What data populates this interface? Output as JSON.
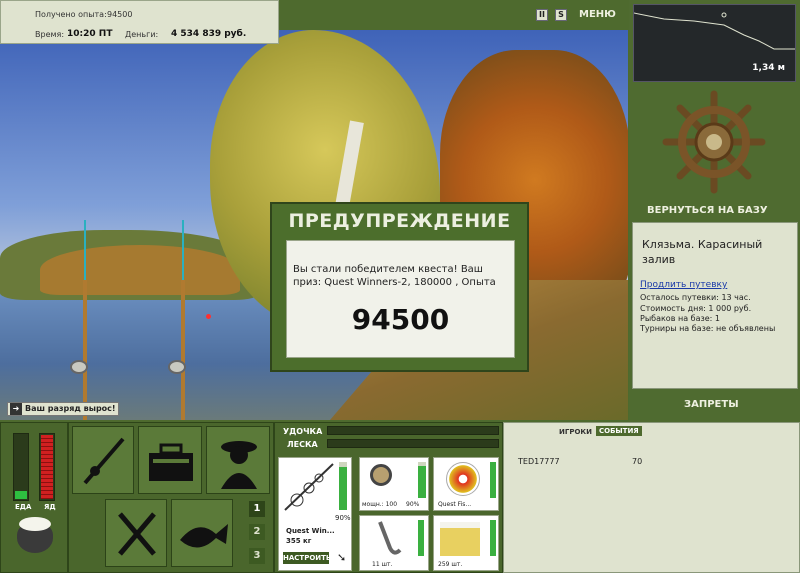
{
  "info": {
    "experience_label": "Получено опыта:",
    "experience_value": "94500",
    "time_label": "Время:",
    "time_value": "10:20 ПТ",
    "money_label": "Деньги:",
    "money_value": "4 534 839 руб."
  },
  "top_controls": {
    "pause": "II",
    "sound": "S",
    "menu": "МЕНЮ"
  },
  "rank_notice": "Ваш разряд вырос!",
  "dialog": {
    "title": "ПРЕДУПРЕЖДЕНИЕ",
    "message": "Вы стали победителем квеста! Ваш приз: Quest Winners-2, 180000 , Опыта",
    "number": "94500"
  },
  "depth": {
    "value": "1,34 м"
  },
  "right_panel": {
    "return_button": "ВЕРНУТЬСЯ НА БАЗУ",
    "location_title": "Клязьма. Карасиный залив",
    "extend_link": "Продлить путевку",
    "lines": [
      "Осталось путевки: 13 час.",
      "Стоимость дня: 1 000 руб.",
      "Рыбаков на базе: 1",
      "Турниры на базе: не объявлены"
    ],
    "bans_button": "ЗАПРЕТЫ"
  },
  "gauges": {
    "food_label": "ЕДА",
    "poison_label": "ЯД"
  },
  "tackle": {
    "rod_label": "УДОЧКА",
    "line_label": "ЛЕСКА",
    "rod_name": "Quest Win...",
    "rod_weight": "355 кг",
    "rod_percent": "90%",
    "setup_button": "НАСТРОИТЬ",
    "reel_caption": "мощн.: 100",
    "reel_percent": "90%",
    "line_caption": "Quest Fis...",
    "hook_caption": "11 шт.",
    "bait_caption": "259 шт."
  },
  "page_buttons": [
    "1",
    "2",
    "3"
  ],
  "events": {
    "tab_players": "ИГРОКИ",
    "tab_events": "СОБЫТИЯ",
    "rows": [
      {
        "player": "TED17777",
        "value": "70"
      }
    ]
  }
}
